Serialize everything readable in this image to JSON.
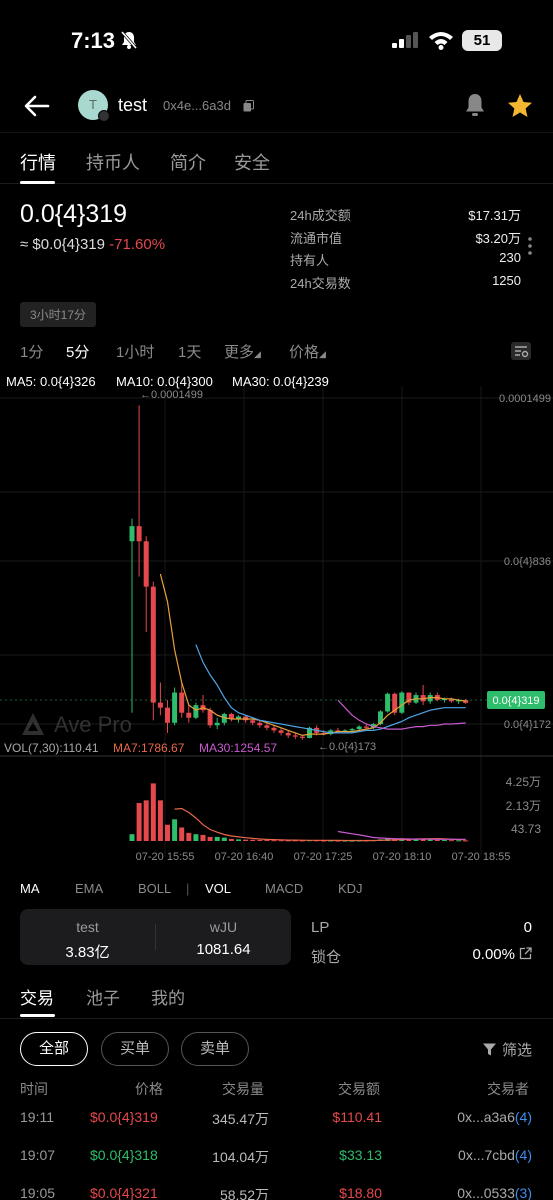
{
  "status_bar": {
    "time": "7:13",
    "battery": "51"
  },
  "header": {
    "token_name": "test",
    "avatar_letter": "T",
    "address": "0x4e...6a3d"
  },
  "tabs": [
    "行情",
    "持币人",
    "简介",
    "安全"
  ],
  "price": {
    "main": "0.0{4}319",
    "usd": "≈ $0.0{4}319",
    "change": "-71.60%"
  },
  "stats": [
    {
      "label": "24h成交额",
      "value": "$17.31万"
    },
    {
      "label": "流通市值",
      "value": "$3.20万"
    },
    {
      "label": "持有人",
      "value": "230"
    },
    {
      "label": "24h交易数",
      "value": "1250"
    }
  ],
  "age_badge": "3小时17分",
  "timeframes": [
    "1分",
    "5分",
    "1小时",
    "1天",
    "更多",
    "价格"
  ],
  "ma_legend": [
    {
      "text": "MA5: 0.0{4}326",
      "color": "#e8a23b"
    },
    {
      "text": "MA10: 0.0{4}300",
      "color": "#4ea4e8"
    },
    {
      "text": "MA30: 0.0{4}239",
      "color": "#c95ad0"
    }
  ],
  "chart_labels": {
    "y_ticks": [
      "0.0001499",
      "0.0{4}836",
      "0.0{4}172"
    ],
    "last_price_tag": "0.0{4}319",
    "high_marker": "←0.0001499",
    "low_marker": "←0.0{4}173",
    "watermark": "Ave Pro",
    "vol_legend": [
      {
        "text": "VOL(7,30):110.41",
        "color": "#aaaaaa"
      },
      {
        "text": "MA7:1786.67",
        "color": "#e8684a"
      },
      {
        "text": "MA30:1254.57",
        "color": "#c95ad0"
      }
    ],
    "vol_ticks": [
      "4.25万",
      "2.13万",
      "43.73"
    ],
    "x_ticks": [
      "07-20 15:55",
      "07-20 16:40",
      "07-20 17:25",
      "07-20 18:10",
      "07-20 18:55"
    ]
  },
  "colors": {
    "up": "#2ebd6b",
    "down": "#e5484d",
    "accent": "#f5b731"
  },
  "chart_data": {
    "type": "candlestick",
    "x_ticks": [
      "07-20 15:55",
      "07-20 16:40",
      "07-20 17:25",
      "07-20 18:10",
      "07-20 18:55"
    ],
    "y_ticks": [
      "0.0001499",
      "0.0{4}836",
      "0.0{4}172"
    ],
    "price_unit": "1e-4",
    "candles": [
      {
        "o": 0.96,
        "h": 1.05,
        "l": 0.28,
        "c": 1.02
      },
      {
        "o": 1.02,
        "h": 1.499,
        "l": 0.82,
        "c": 0.96
      },
      {
        "o": 0.96,
        "h": 0.98,
        "l": 0.6,
        "c": 0.78
      },
      {
        "o": 0.78,
        "h": 0.8,
        "l": 0.25,
        "c": 0.32
      },
      {
        "o": 0.32,
        "h": 0.4,
        "l": 0.27,
        "c": 0.3
      },
      {
        "o": 0.3,
        "h": 0.33,
        "l": 0.2,
        "c": 0.24
      },
      {
        "o": 0.24,
        "h": 0.38,
        "l": 0.23,
        "c": 0.36
      },
      {
        "o": 0.36,
        "h": 0.4,
        "l": 0.26,
        "c": 0.28
      },
      {
        "o": 0.28,
        "h": 0.31,
        "l": 0.24,
        "c": 0.26
      },
      {
        "o": 0.26,
        "h": 0.32,
        "l": 0.255,
        "c": 0.31
      },
      {
        "o": 0.31,
        "h": 0.35,
        "l": 0.28,
        "c": 0.29
      },
      {
        "o": 0.29,
        "h": 0.3,
        "l": 0.22,
        "c": 0.23
      },
      {
        "o": 0.23,
        "h": 0.26,
        "l": 0.215,
        "c": 0.24
      },
      {
        "o": 0.24,
        "h": 0.28,
        "l": 0.23,
        "c": 0.275
      },
      {
        "o": 0.275,
        "h": 0.28,
        "l": 0.245,
        "c": 0.255
      },
      {
        "o": 0.255,
        "h": 0.27,
        "l": 0.24,
        "c": 0.265
      },
      {
        "o": 0.265,
        "h": 0.27,
        "l": 0.24,
        "c": 0.25
      },
      {
        "o": 0.25,
        "h": 0.26,
        "l": 0.23,
        "c": 0.24
      },
      {
        "o": 0.24,
        "h": 0.25,
        "l": 0.22,
        "c": 0.23
      },
      {
        "o": 0.23,
        "h": 0.24,
        "l": 0.21,
        "c": 0.22
      },
      {
        "o": 0.22,
        "h": 0.23,
        "l": 0.2,
        "c": 0.21
      },
      {
        "o": 0.21,
        "h": 0.22,
        "l": 0.19,
        "c": 0.2
      },
      {
        "o": 0.2,
        "h": 0.21,
        "l": 0.18,
        "c": 0.19
      },
      {
        "o": 0.19,
        "h": 0.2,
        "l": 0.175,
        "c": 0.185
      },
      {
        "o": 0.185,
        "h": 0.19,
        "l": 0.173,
        "c": 0.18
      },
      {
        "o": 0.18,
        "h": 0.225,
        "l": 0.178,
        "c": 0.22
      },
      {
        "o": 0.22,
        "h": 0.23,
        "l": 0.19,
        "c": 0.2
      },
      {
        "o": 0.2,
        "h": 0.21,
        "l": 0.19,
        "c": 0.195
      },
      {
        "o": 0.195,
        "h": 0.215,
        "l": 0.19,
        "c": 0.21
      },
      {
        "o": 0.21,
        "h": 0.22,
        "l": 0.2,
        "c": 0.205
      },
      {
        "o": 0.205,
        "h": 0.215,
        "l": 0.2,
        "c": 0.21
      },
      {
        "o": 0.21,
        "h": 0.22,
        "l": 0.205,
        "c": 0.215
      },
      {
        "o": 0.215,
        "h": 0.23,
        "l": 0.21,
        "c": 0.225
      },
      {
        "o": 0.225,
        "h": 0.235,
        "l": 0.215,
        "c": 0.22
      },
      {
        "o": 0.22,
        "h": 0.24,
        "l": 0.215,
        "c": 0.235
      },
      {
        "o": 0.235,
        "h": 0.29,
        "l": 0.23,
        "c": 0.285
      },
      {
        "o": 0.285,
        "h": 0.36,
        "l": 0.28,
        "c": 0.355
      },
      {
        "o": 0.355,
        "h": 0.36,
        "l": 0.27,
        "c": 0.28
      },
      {
        "o": 0.28,
        "h": 0.365,
        "l": 0.275,
        "c": 0.36
      },
      {
        "o": 0.36,
        "h": 0.36,
        "l": 0.31,
        "c": 0.32
      },
      {
        "o": 0.32,
        "h": 0.36,
        "l": 0.315,
        "c": 0.35
      },
      {
        "o": 0.35,
        "h": 0.39,
        "l": 0.31,
        "c": 0.325
      },
      {
        "o": 0.325,
        "h": 0.36,
        "l": 0.315,
        "c": 0.35
      },
      {
        "o": 0.35,
        "h": 0.36,
        "l": 0.325,
        "c": 0.33
      },
      {
        "o": 0.33,
        "h": 0.34,
        "l": 0.32,
        "c": 0.335
      },
      {
        "o": 0.335,
        "h": 0.34,
        "l": 0.32,
        "c": 0.325
      },
      {
        "o": 0.325,
        "h": 0.335,
        "l": 0.315,
        "c": 0.33
      },
      {
        "o": 0.33,
        "h": 0.335,
        "l": 0.315,
        "c": 0.319
      }
    ],
    "ma5": [
      null,
      null,
      null,
      null,
      0.83,
      0.72,
      0.53,
      0.4,
      0.31,
      0.29,
      0.3,
      0.29,
      0.27,
      0.26,
      0.255,
      0.255,
      0.255,
      0.255,
      0.25,
      0.24,
      0.23,
      0.22,
      0.21,
      0.2,
      0.19,
      0.195,
      0.195,
      0.195,
      0.2,
      0.205,
      0.205,
      0.205,
      0.21,
      0.215,
      0.22,
      0.24,
      0.27,
      0.29,
      0.31,
      0.33,
      0.335,
      0.335,
      0.34,
      0.34,
      0.335,
      0.335,
      0.33,
      0.326
    ],
    "ma10": [
      null,
      null,
      null,
      null,
      null,
      null,
      null,
      null,
      null,
      0.55,
      0.48,
      0.43,
      0.39,
      0.34,
      0.3,
      0.28,
      0.27,
      0.26,
      0.25,
      0.245,
      0.24,
      0.235,
      0.23,
      0.225,
      0.22,
      0.215,
      0.21,
      0.205,
      0.2,
      0.2,
      0.2,
      0.2,
      0.205,
      0.21,
      0.21,
      0.215,
      0.225,
      0.235,
      0.245,
      0.26,
      0.27,
      0.28,
      0.29,
      0.295,
      0.3,
      0.3,
      0.3,
      0.3
    ],
    "ma30": [
      null,
      null,
      null,
      null,
      null,
      null,
      null,
      null,
      null,
      null,
      null,
      null,
      null,
      null,
      null,
      null,
      null,
      null,
      null,
      null,
      null,
      null,
      null,
      null,
      null,
      null,
      null,
      null,
      null,
      0.33,
      0.3,
      0.27,
      0.25,
      0.235,
      0.225,
      0.22,
      0.215,
      0.215,
      0.215,
      0.22,
      0.225,
      0.225,
      0.23,
      0.23,
      0.235,
      0.235,
      0.237,
      0.239
    ],
    "volume": [
      5000,
      28000,
      30000,
      42500,
      30000,
      12000,
      16000,
      10000,
      6000,
      5000,
      4500,
      3000,
      3000,
      2500,
      1500,
      1200,
      1000,
      900,
      800,
      700,
      600,
      600,
      500,
      500,
      400,
      600,
      500,
      400,
      400,
      300,
      300,
      300,
      400,
      400,
      600,
      1200,
      1800,
      1500,
      2000,
      1500,
      1200,
      1500,
      1000,
      800,
      700,
      600,
      500,
      400
    ],
    "vol_up": [
      true,
      false,
      false,
      false,
      false,
      false,
      true,
      false,
      false,
      true,
      false,
      false,
      true,
      true,
      false,
      true,
      false,
      false,
      false,
      false,
      false,
      false,
      false,
      false,
      false,
      true,
      false,
      false,
      true,
      false,
      true,
      true,
      true,
      false,
      true,
      true,
      true,
      false,
      true,
      false,
      true,
      false,
      true,
      false,
      true,
      false,
      true,
      false
    ],
    "vol_ma7": [
      null,
      null,
      null,
      null,
      null,
      null,
      23500,
      24000,
      21000,
      17000,
      12000,
      8500,
      6500,
      4800,
      3700,
      3000,
      2400,
      1900,
      1500,
      1200,
      1000,
      850,
      700,
      650,
      560,
      540,
      520,
      500,
      460,
      420,
      400,
      380,
      380,
      380,
      400,
      500,
      700,
      850,
      1000,
      1250,
      1450,
      1600,
      1700,
      1786.67,
      1600,
      1300,
      1100,
      900
    ],
    "vol_ma30": [
      null,
      null,
      null,
      null,
      null,
      null,
      null,
      null,
      null,
      null,
      null,
      null,
      null,
      null,
      null,
      null,
      null,
      null,
      null,
      null,
      null,
      null,
      null,
      null,
      null,
      null,
      null,
      null,
      null,
      7000,
      6200,
      5300,
      4500,
      3600,
      2600,
      2200,
      1900,
      1700,
      1550,
      1450,
      1400,
      1350,
      1300,
      1280,
      1270,
      1265,
      1260,
      1254.57
    ],
    "price_range": [
      0.14,
      1.56
    ],
    "volume_range": [
      0,
      45000
    ]
  },
  "indicator_tabs": [
    "MA",
    "EMA",
    "BOLL",
    "VOL",
    "MACD",
    "KDJ"
  ],
  "pair_box": [
    {
      "label": "test",
      "value": "3.83亿"
    },
    {
      "label": "wJU",
      "value": "1081.64"
    }
  ],
  "lp": {
    "label": "LP",
    "value": "0"
  },
  "lock": {
    "label": "锁仓",
    "value": "0.00%"
  },
  "sub_tabs": [
    "交易",
    "池子",
    "我的"
  ],
  "filters": [
    "全部",
    "买单",
    "卖单"
  ],
  "filter_button": "筛选",
  "table_headers": [
    "时间",
    "价格",
    "交易量",
    "交易额",
    "交易者"
  ],
  "trades": [
    {
      "time": "19:11",
      "price": "$0.0{4}319",
      "qty": "345.47万",
      "amount": "$110.41",
      "trader": "0x...a3a6",
      "count": "(4)",
      "side": "sell"
    },
    {
      "time": "19:07",
      "price": "$0.0{4}318",
      "qty": "104.04万",
      "amount": "$33.13",
      "trader": "0x...7cbd",
      "count": "(4)",
      "side": "buy"
    },
    {
      "time": "19:05",
      "price": "$0.0{4}321",
      "qty": "58.52万",
      "amount": "$18.80",
      "trader": "0x...0533",
      "count": "(3)",
      "side": "sell"
    }
  ]
}
